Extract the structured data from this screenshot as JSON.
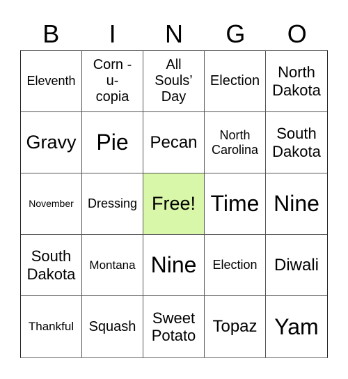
{
  "header": {
    "letters": [
      "B",
      "I",
      "N",
      "G",
      "O"
    ]
  },
  "grid": {
    "free_color": "#d9f7a8",
    "rows": [
      [
        "Eleventh",
        "Corn - u-copia",
        "All Souls' Day",
        "Election",
        "North Dakota"
      ],
      [
        "Gravy",
        "Pie",
        "Pecan",
        "North Carolina",
        "South Dakota"
      ],
      [
        "November",
        "Dressing",
        "Free!",
        "Time",
        "Nine"
      ],
      [
        "South Dakota",
        "Montana",
        "Nine",
        "Election",
        "Diwali"
      ],
      [
        "Thankful",
        "Squash",
        "Sweet Potato",
        "Topaz",
        "Yam"
      ]
    ],
    "display_lines": [
      [
        [
          "Eleventh"
        ],
        [
          "Corn -",
          "u-",
          "copia"
        ],
        [
          "All",
          "Souls’",
          "Day"
        ],
        [
          "Election"
        ],
        [
          "North",
          "Dakota"
        ]
      ],
      [
        [
          "Gravy"
        ],
        [
          "Pie"
        ],
        [
          "Pecan"
        ],
        [
          "North",
          "Carolina"
        ],
        [
          "South",
          "Dakota"
        ]
      ],
      [
        [
          "November"
        ],
        [
          "Dressing"
        ],
        [
          "Free!"
        ],
        [
          "Time"
        ],
        [
          "Nine"
        ]
      ],
      [
        [
          "South",
          "Dakota"
        ],
        [
          "Montana"
        ],
        [
          "Nine"
        ],
        [
          "Election"
        ],
        [
          "Diwali"
        ]
      ],
      [
        [
          "Thankful"
        ],
        [
          "Squash"
        ],
        [
          "Sweet",
          "Potato"
        ],
        [
          "Topaz"
        ],
        [
          "Yam"
        ]
      ]
    ]
  }
}
